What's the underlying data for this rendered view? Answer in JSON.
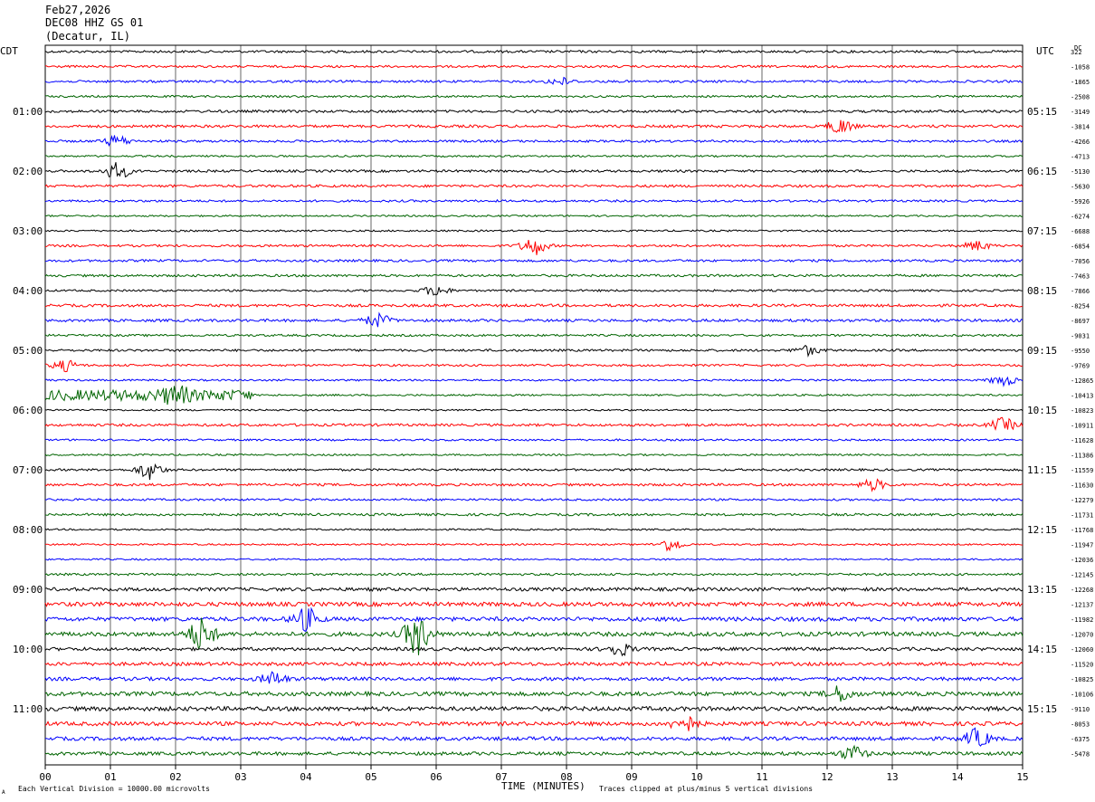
{
  "header": {
    "date": "Feb27,2026",
    "station": "DEC08 HHZ GS 01",
    "location": "(Decatur, IL)"
  },
  "labels": {
    "left_tz": "CDT",
    "right_tz": "UTC",
    "dc": "DC",
    "footer_left": "Each Vertical Division = 10000.00 microvolts",
    "footer_right": "Traces clipped at plus/minus 5 vertical divisions",
    "corner_mark": "A"
  },
  "colors": {
    "trace_cycle": [
      "#000000",
      "#ff0000",
      "#0000ff",
      "#006400"
    ],
    "grid": "#000000",
    "background": "#ffffff"
  },
  "chart_data": {
    "type": "line",
    "subtype": "helicorder",
    "xlabel": "TIME (MINUTES)",
    "x_ticks": [
      "00",
      "01",
      "02",
      "03",
      "04",
      "05",
      "06",
      "07",
      "08",
      "09",
      "10",
      "11",
      "12",
      "13",
      "14",
      "15"
    ],
    "xlim": [
      0,
      15
    ],
    "left_hour_labels": [
      "01:00",
      "02:00",
      "03:00",
      "04:00",
      "05:00",
      "06:00",
      "07:00",
      "08:00",
      "09:00",
      "10:00",
      "11:00"
    ],
    "right_hour_labels": [
      "05:15",
      "06:15",
      "07:15",
      "08:15",
      "09:15",
      "10:15",
      "11:15",
      "12:15",
      "13:15",
      "14:15",
      "15:15"
    ],
    "hour_label_rows": [
      4,
      8,
      12,
      16,
      20,
      24,
      28,
      32,
      36,
      40,
      44
    ],
    "dc_offsets": [
      "322",
      "-1058",
      "-1865",
      "-2508",
      "-3149",
      "-3814",
      "-4266",
      "-4713",
      "-5130",
      "-5630",
      "-5926",
      "-6274",
      "-6688",
      "-6854",
      "-7056",
      "-7463",
      "-7866",
      "-8254",
      "-8697",
      "-9031",
      "-9550",
      "-9769",
      "-12865",
      "-10413",
      "-10823",
      "-10911",
      "-11628",
      "-11386",
      "-11559",
      "-11630",
      "-12279",
      "-11731",
      "-11768",
      "-11947",
      "-12036",
      "-12145",
      "-12268",
      "-12137",
      "-11982",
      "-12070",
      "-12060",
      "-11520",
      "-10825",
      "-10106",
      "-9110",
      "-8053",
      "-6375",
      "-5478"
    ],
    "activity": [
      {
        "row": 2,
        "minute": 7.9,
        "amp": 4
      },
      {
        "row": 5,
        "minute": 12.2,
        "amp": 8
      },
      {
        "row": 6,
        "minute": 1.1,
        "amp": 6
      },
      {
        "row": 8,
        "minute": 1.1,
        "amp": 9
      },
      {
        "row": 13,
        "minute": 7.5,
        "amp": 10
      },
      {
        "row": 13,
        "minute": 14.3,
        "amp": 5
      },
      {
        "row": 16,
        "minute": 6.0,
        "amp": 6
      },
      {
        "row": 18,
        "minute": 5.1,
        "amp": 7
      },
      {
        "row": 20,
        "minute": 11.7,
        "amp": 5
      },
      {
        "row": 21,
        "minute": 0.3,
        "amp": 6
      },
      {
        "row": 22,
        "minute": 14.7,
        "amp": 6
      },
      {
        "row": 23,
        "minute": 2.0,
        "amp": 8
      },
      {
        "row": 25,
        "minute": 14.7,
        "amp": 7
      },
      {
        "row": 28,
        "minute": 1.6,
        "amp": 10
      },
      {
        "row": 29,
        "minute": 12.7,
        "amp": 6
      },
      {
        "row": 33,
        "minute": 9.6,
        "amp": 7
      },
      {
        "row": 38,
        "minute": 4.0,
        "amp": 12
      },
      {
        "row": 39,
        "minute": 5.7,
        "amp": 22
      },
      {
        "row": 39,
        "minute": 2.4,
        "amp": 18
      },
      {
        "row": 40,
        "minute": 8.8,
        "amp": 7
      },
      {
        "row": 42,
        "minute": 3.5,
        "amp": 7
      },
      {
        "row": 43,
        "minute": 12.2,
        "amp": 8
      },
      {
        "row": 45,
        "minute": 9.8,
        "amp": 9
      },
      {
        "row": 46,
        "minute": 14.3,
        "amp": 10
      },
      {
        "row": 47,
        "minute": 12.4,
        "amp": 8
      }
    ]
  }
}
